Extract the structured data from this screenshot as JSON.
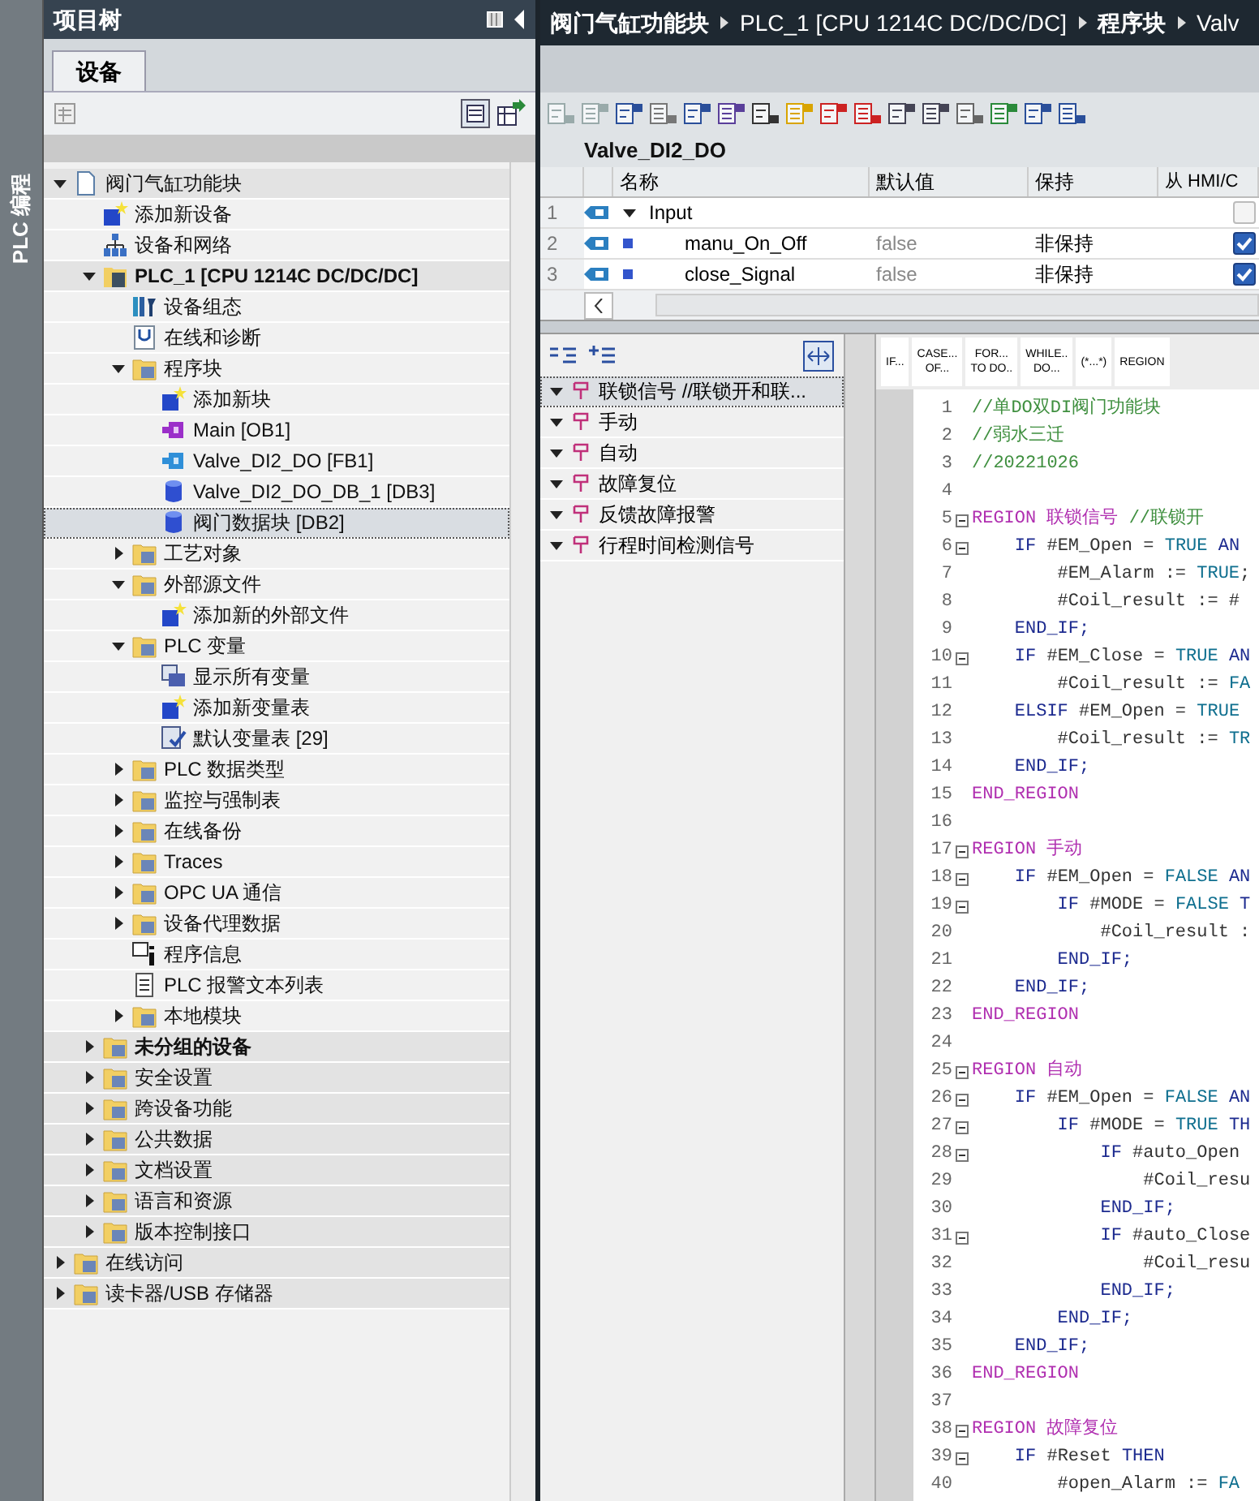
{
  "side_strip": {
    "label": "PLC 编程"
  },
  "project_tree": {
    "title": "项目树",
    "tabs": [
      {
        "label": "设备",
        "selected": true
      }
    ],
    "items": [
      {
        "text": "阀门气缸功能块",
        "kind": "project",
        "expanded": true,
        "selected": false,
        "children": [
          {
            "text": "添加新设备",
            "kind": "add",
            "selected": false
          },
          {
            "text": "设备和网络",
            "kind": "network",
            "selected": false
          },
          {
            "text": "PLC_1 [CPU 1214C DC/DC/DC]",
            "kind": "plc",
            "bold": true,
            "expanded": true,
            "selected": false,
            "children": [
              {
                "text": "设备组态",
                "kind": "config",
                "selected": false
              },
              {
                "text": "在线和诊断",
                "kind": "diag",
                "selected": false
              },
              {
                "text": "程序块",
                "kind": "folder",
                "expanded": true,
                "selected": false,
                "children": [
                  {
                    "text": "添加新块",
                    "kind": "add",
                    "selected": false
                  },
                  {
                    "text": "Main [OB1]",
                    "kind": "ob",
                    "selected": false
                  },
                  {
                    "text": "Valve_DI2_DO [FB1]",
                    "kind": "fb",
                    "selected": false
                  },
                  {
                    "text": "Valve_DI2_DO_DB_1 [DB3]",
                    "kind": "db",
                    "selected": false
                  },
                  {
                    "text": "阀门数据块 [DB2]",
                    "kind": "db",
                    "selected": true
                  }
                ]
              },
              {
                "text": "工艺对象",
                "kind": "folder",
                "expanded": false,
                "selected": false
              },
              {
                "text": "外部源文件",
                "kind": "folder",
                "expanded": true,
                "selected": false,
                "children": [
                  {
                    "text": "添加新的外部文件",
                    "kind": "add",
                    "selected": false
                  }
                ]
              },
              {
                "text": "PLC 变量",
                "kind": "folder",
                "expanded": true,
                "selected": false,
                "children": [
                  {
                    "text": "显示所有变量",
                    "kind": "tags",
                    "selected": false
                  },
                  {
                    "text": "添加新变量表",
                    "kind": "add",
                    "selected": false
                  },
                  {
                    "text": "默认变量表 [29]",
                    "kind": "tagtable",
                    "selected": false
                  }
                ]
              },
              {
                "text": "PLC 数据类型",
                "kind": "folder",
                "expanded": false,
                "selected": false
              },
              {
                "text": "监控与强制表",
                "kind": "folder",
                "expanded": false,
                "selected": false
              },
              {
                "text": "在线备份",
                "kind": "folder",
                "expanded": false,
                "selected": false
              },
              {
                "text": "Traces",
                "kind": "folder",
                "expanded": false,
                "selected": false
              },
              {
                "text": "OPC UA 通信",
                "kind": "folder",
                "expanded": false,
                "selected": false
              },
              {
                "text": "设备代理数据",
                "kind": "folder",
                "expanded": false,
                "selected": false
              },
              {
                "text": "程序信息",
                "kind": "info",
                "selected": false
              },
              {
                "text": "PLC 报警文本列表",
                "kind": "textlist",
                "selected": false
              },
              {
                "text": "本地模块",
                "kind": "folder",
                "expanded": false,
                "selected": false
              }
            ]
          },
          {
            "text": "未分组的设备",
            "kind": "folder",
            "bold": true,
            "expanded": false,
            "selected": false
          },
          {
            "text": "安全设置",
            "kind": "folder",
            "expanded": false,
            "selected": false
          },
          {
            "text": "跨设备功能",
            "kind": "folder",
            "expanded": false,
            "selected": false
          },
          {
            "text": "公共数据",
            "kind": "folder",
            "expanded": false,
            "selected": false
          },
          {
            "text": "文档设置",
            "kind": "folder",
            "expanded": false,
            "selected": false
          },
          {
            "text": "语言和资源",
            "kind": "folder",
            "expanded": false,
            "selected": false
          },
          {
            "text": "版本控制接口",
            "kind": "folder",
            "expanded": false,
            "selected": false
          }
        ]
      },
      {
        "text": "在线访问",
        "kind": "folder",
        "expanded": false,
        "selected": false
      },
      {
        "text": "读卡器/USB 存储器",
        "kind": "folder",
        "expanded": false,
        "selected": false
      }
    ]
  },
  "breadcrumb": [
    "阀门气缸功能块",
    "PLC_1 [CPU 1214C DC/DC/DC]",
    "程序块",
    "Valv"
  ],
  "block_title": "Valve_DI2_DO",
  "interface_table": {
    "columns": [
      "名称",
      "默认值",
      "保持",
      "从 HMI/C"
    ],
    "rows": [
      {
        "no": "1",
        "name": "Input",
        "kind": "section",
        "expanded": true,
        "hmi_checked": false
      },
      {
        "no": "2",
        "name": "manu_On_Off",
        "kind": "variable",
        "default": "false",
        "retain": "非保持",
        "hmi_checked": true
      },
      {
        "no": "3",
        "name": "close_Signal",
        "kind": "variable",
        "default": "false",
        "retain": "非保持",
        "hmi_checked": true
      }
    ]
  },
  "regions": [
    {
      "text": "联锁信号 //联锁开和联...",
      "expanded": true,
      "selected": true
    },
    {
      "text": "手动",
      "expanded": true,
      "selected": false
    },
    {
      "text": "自动",
      "expanded": true,
      "selected": false
    },
    {
      "text": "故障复位",
      "expanded": true,
      "selected": false
    },
    {
      "text": "反馈故障报警",
      "expanded": true,
      "selected": false
    },
    {
      "text": "行程时间检测信号",
      "expanded": true,
      "selected": false
    }
  ],
  "snippets": [
    [
      "IF..."
    ],
    [
      "CASE...",
      "OF..."
    ],
    [
      "FOR...",
      "TO DO.."
    ],
    [
      "WHILE..",
      "DO..."
    ],
    [
      "(*...*)"
    ],
    [
      "REGION"
    ]
  ],
  "code": [
    {
      "no": "1",
      "fold": false,
      "tokens": [
        {
          "kind": "cm",
          "text": "//单DO双DI阀门功能块"
        }
      ]
    },
    {
      "no": "2",
      "fold": false,
      "tokens": [
        {
          "kind": "cm",
          "text": "//弱水三迁"
        }
      ]
    },
    {
      "no": "3",
      "fold": false,
      "tokens": [
        {
          "kind": "cm",
          "text": "//20221026"
        }
      ]
    },
    {
      "no": "4",
      "fold": false
    },
    {
      "no": "5",
      "fold": true,
      "tokens": [
        {
          "kind": "kw",
          "text": "REGION 联锁信号 "
        },
        {
          "kind": "cm",
          "text": "//联锁开"
        }
      ]
    },
    {
      "no": "6",
      "fold": true,
      "tokens": [
        {
          "kind": "ctl",
          "text": "    IF "
        },
        {
          "kind": "id",
          "text": "#EM_Open = "
        },
        {
          "kind": "const",
          "text": "TRUE "
        },
        {
          "kind": "ctl",
          "text": "AN"
        }
      ]
    },
    {
      "no": "7",
      "fold": false,
      "tokens": [
        {
          "kind": "id",
          "text": "        #EM_Alarm := "
        },
        {
          "kind": "const",
          "text": "TRUE"
        },
        {
          "kind": "id",
          "text": ";"
        }
      ]
    },
    {
      "no": "8",
      "fold": false,
      "tokens": [
        {
          "kind": "id",
          "text": "        #Coil_result := #"
        }
      ]
    },
    {
      "no": "9",
      "fold": false,
      "tokens": [
        {
          "kind": "ctl",
          "text": "    END_IF;"
        }
      ]
    },
    {
      "no": "10",
      "fold": true,
      "tokens": [
        {
          "kind": "ctl",
          "text": "    IF "
        },
        {
          "kind": "id",
          "text": "#EM_Close = "
        },
        {
          "kind": "const",
          "text": "TRUE "
        },
        {
          "kind": "ctl",
          "text": "AN"
        }
      ]
    },
    {
      "no": "11",
      "fold": false,
      "tokens": [
        {
          "kind": "id",
          "text": "        #Coil_result := "
        },
        {
          "kind": "const",
          "text": "FA"
        }
      ]
    },
    {
      "no": "12",
      "fold": false,
      "tokens": [
        {
          "kind": "ctl",
          "text": "    ELSIF "
        },
        {
          "kind": "id",
          "text": "#EM_Open = "
        },
        {
          "kind": "const",
          "text": "TRUE"
        }
      ]
    },
    {
      "no": "13",
      "fold": false,
      "tokens": [
        {
          "kind": "id",
          "text": "        #Coil_result := "
        },
        {
          "kind": "const",
          "text": "TR"
        }
      ]
    },
    {
      "no": "14",
      "fold": false,
      "tokens": [
        {
          "kind": "ctl",
          "text": "    END_IF;"
        }
      ]
    },
    {
      "no": "15",
      "fold": false,
      "tokens": [
        {
          "kind": "kw",
          "text": "END_REGION"
        }
      ]
    },
    {
      "no": "16",
      "fold": false
    },
    {
      "no": "17",
      "fold": true,
      "tokens": [
        {
          "kind": "kw",
          "text": "REGION 手动"
        }
      ]
    },
    {
      "no": "18",
      "fold": true,
      "tokens": [
        {
          "kind": "ctl",
          "text": "    IF "
        },
        {
          "kind": "id",
          "text": "#EM_Open = "
        },
        {
          "kind": "const",
          "text": "FALSE "
        },
        {
          "kind": "ctl",
          "text": "AN"
        }
      ]
    },
    {
      "no": "19",
      "fold": true,
      "tokens": [
        {
          "kind": "ctl",
          "text": "        IF "
        },
        {
          "kind": "id",
          "text": "#MODE = "
        },
        {
          "kind": "const",
          "text": "FALSE "
        },
        {
          "kind": "ctl",
          "text": "T"
        }
      ]
    },
    {
      "no": "20",
      "fold": false,
      "tokens": [
        {
          "kind": "id",
          "text": "            #Coil_result :"
        }
      ]
    },
    {
      "no": "21",
      "fold": false,
      "tokens": [
        {
          "kind": "ctl",
          "text": "        END_IF;"
        }
      ]
    },
    {
      "no": "22",
      "fold": false,
      "tokens": [
        {
          "kind": "ctl",
          "text": "    END_IF;"
        }
      ]
    },
    {
      "no": "23",
      "fold": false,
      "tokens": [
        {
          "kind": "kw",
          "text": "END_REGION"
        }
      ]
    },
    {
      "no": "24",
      "fold": false
    },
    {
      "no": "25",
      "fold": true,
      "tokens": [
        {
          "kind": "kw",
          "text": "REGION 自动"
        }
      ]
    },
    {
      "no": "26",
      "fold": true,
      "tokens": [
        {
          "kind": "ctl",
          "text": "    IF "
        },
        {
          "kind": "id",
          "text": "#EM_Open = "
        },
        {
          "kind": "const",
          "text": "FALSE "
        },
        {
          "kind": "ctl",
          "text": "AN"
        }
      ]
    },
    {
      "no": "27",
      "fold": true,
      "tokens": [
        {
          "kind": "ctl",
          "text": "        IF "
        },
        {
          "kind": "id",
          "text": "#MODE = "
        },
        {
          "kind": "const",
          "text": "TRUE "
        },
        {
          "kind": "ctl",
          "text": "TH"
        }
      ]
    },
    {
      "no": "28",
      "fold": true,
      "tokens": [
        {
          "kind": "ctl",
          "text": "            IF "
        },
        {
          "kind": "id",
          "text": "#auto_Open"
        }
      ]
    },
    {
      "no": "29",
      "fold": false,
      "tokens": [
        {
          "kind": "id",
          "text": "                #Coil_resu"
        }
      ]
    },
    {
      "no": "30",
      "fold": false,
      "tokens": [
        {
          "kind": "ctl",
          "text": "            END_IF;"
        }
      ]
    },
    {
      "no": "31",
      "fold": true,
      "tokens": [
        {
          "kind": "ctl",
          "text": "            IF "
        },
        {
          "kind": "id",
          "text": "#auto_Close"
        }
      ]
    },
    {
      "no": "32",
      "fold": false,
      "tokens": [
        {
          "kind": "id",
          "text": "                #Coil_resu"
        }
      ]
    },
    {
      "no": "33",
      "fold": false,
      "tokens": [
        {
          "kind": "ctl",
          "text": "            END_IF;"
        }
      ]
    },
    {
      "no": "34",
      "fold": false,
      "tokens": [
        {
          "kind": "ctl",
          "text": "        END_IF;"
        }
      ]
    },
    {
      "no": "35",
      "fold": false,
      "tokens": [
        {
          "kind": "ctl",
          "text": "    END_IF;"
        }
      ]
    },
    {
      "no": "36",
      "fold": false,
      "tokens": [
        {
          "kind": "kw",
          "text": "END_REGION"
        }
      ]
    },
    {
      "no": "37",
      "fold": false
    },
    {
      "no": "38",
      "fold": true,
      "tokens": [
        {
          "kind": "kw",
          "text": "REGION 故障复位"
        }
      ]
    },
    {
      "no": "39",
      "fold": true,
      "tokens": [
        {
          "kind": "ctl",
          "text": "    IF "
        },
        {
          "kind": "id",
          "text": "#Reset "
        },
        {
          "kind": "ctl",
          "text": "THEN"
        }
      ]
    },
    {
      "no": "40",
      "fold": false,
      "tokens": [
        {
          "kind": "id",
          "text": "        #open_Alarm := "
        },
        {
          "kind": "const",
          "text": "FA"
        }
      ]
    }
  ]
}
